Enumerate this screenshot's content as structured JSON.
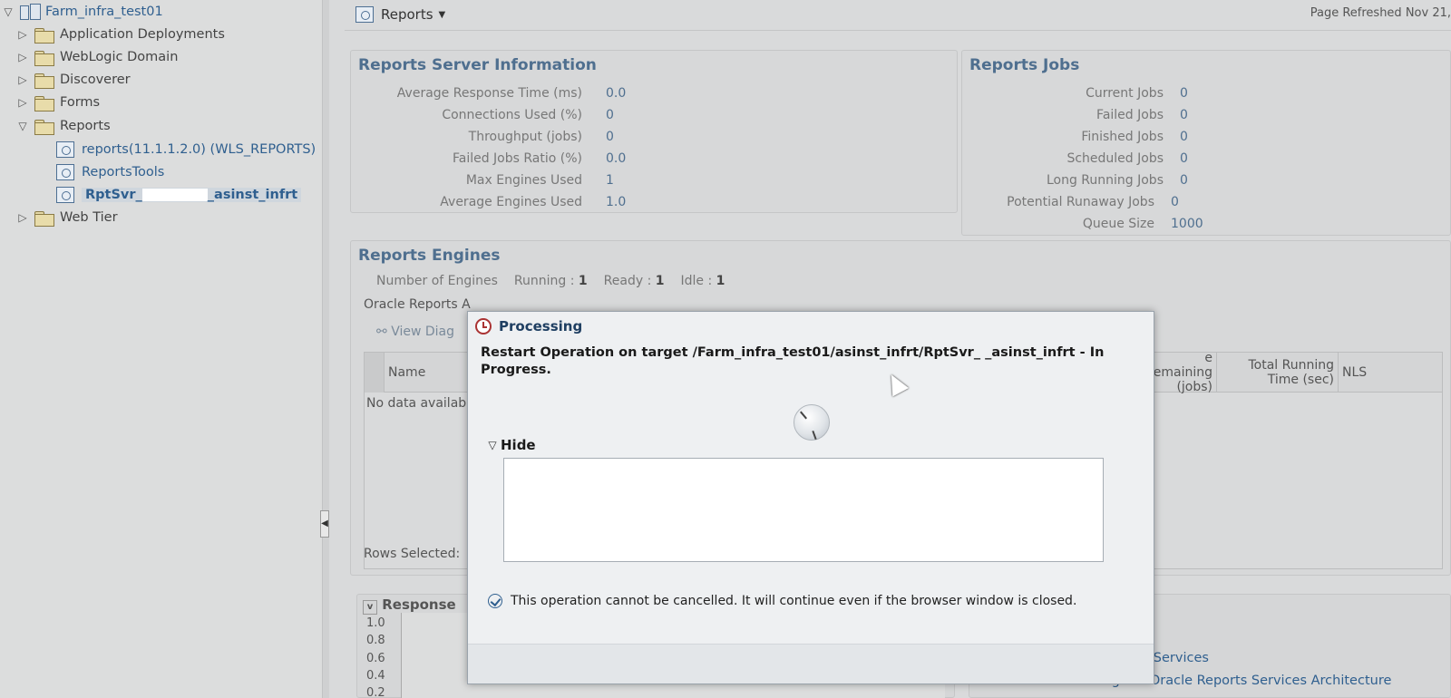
{
  "nav": {
    "farm_label": "Farm_infra_test01",
    "items": [
      {
        "label": "Application Deployments"
      },
      {
        "label": "WebLogic Domain"
      },
      {
        "label": "Discoverer"
      },
      {
        "label": "Forms"
      },
      {
        "label": "Reports"
      },
      {
        "label": "reports(11.1.1.2.0) (WLS_REPORTS)"
      },
      {
        "label": "ReportsTools"
      },
      {
        "label": "RptSvr_",
        "label_suffix": "_asinst_infrt"
      },
      {
        "label": "Web Tier"
      }
    ]
  },
  "header": {
    "menu_label": "Reports",
    "refreshed": "Page Refreshed Nov 21,"
  },
  "server_info": {
    "title": "Reports Server Information",
    "rows": [
      {
        "label": "Average Response Time (ms)",
        "value": "0.0"
      },
      {
        "label": "Connections Used (%)",
        "value": "0"
      },
      {
        "label": "Throughput (jobs)",
        "value": "0"
      },
      {
        "label": "Failed Jobs Ratio (%)",
        "value": "0.0"
      },
      {
        "label": "Max Engines Used",
        "value": "1"
      },
      {
        "label": "Average Engines Used",
        "value": "1.0"
      }
    ]
  },
  "jobs": {
    "title": "Reports Jobs",
    "rows": [
      {
        "label": "Current Jobs",
        "value": "0"
      },
      {
        "label": "Failed Jobs",
        "value": "0"
      },
      {
        "label": "Finished Jobs",
        "value": "0"
      },
      {
        "label": "Scheduled Jobs",
        "value": "0"
      },
      {
        "label": "Long Running Jobs",
        "value": "0"
      },
      {
        "label": "Potential Runaway Jobs",
        "value": "0"
      },
      {
        "label": "Queue Size",
        "value": "1000"
      }
    ]
  },
  "engines": {
    "title": "Reports Engines",
    "number_label": "Number of Engines",
    "running_label": "Running :",
    "running_value": "1",
    "ready_label": "Ready :",
    "ready_value": "1",
    "idle_label": "Idle :",
    "idle_value": "1",
    "desc_partial": "Oracle Reports A",
    "view_diag_label": "View Diag",
    "columns": {
      "name": "Name",
      "remaining": "e Remaining (jobs)",
      "total_running": "Total Running Time (sec)",
      "nls": "NLS"
    },
    "no_data": "No data availab",
    "rows_selected": "Rows Selected:"
  },
  "response_chart": {
    "title": "Response",
    "ticks": [
      "1.0",
      "0.8",
      "0.6",
      "0.4",
      "0.2"
    ]
  },
  "links": {
    "services_partial": "rts Services",
    "architecture_partial": "Understanding the Oracle Reports Services Architecture"
  },
  "dialog": {
    "title": "Processing",
    "message": "Restart Operation on target /Farm_infra_test01/asinst_infrt/RptSvr_ _asinst_infrt - In Progress.",
    "hide_label": "Hide",
    "details": "",
    "note": "This operation cannot be cancelled. It will continue even if the browser window is closed."
  }
}
